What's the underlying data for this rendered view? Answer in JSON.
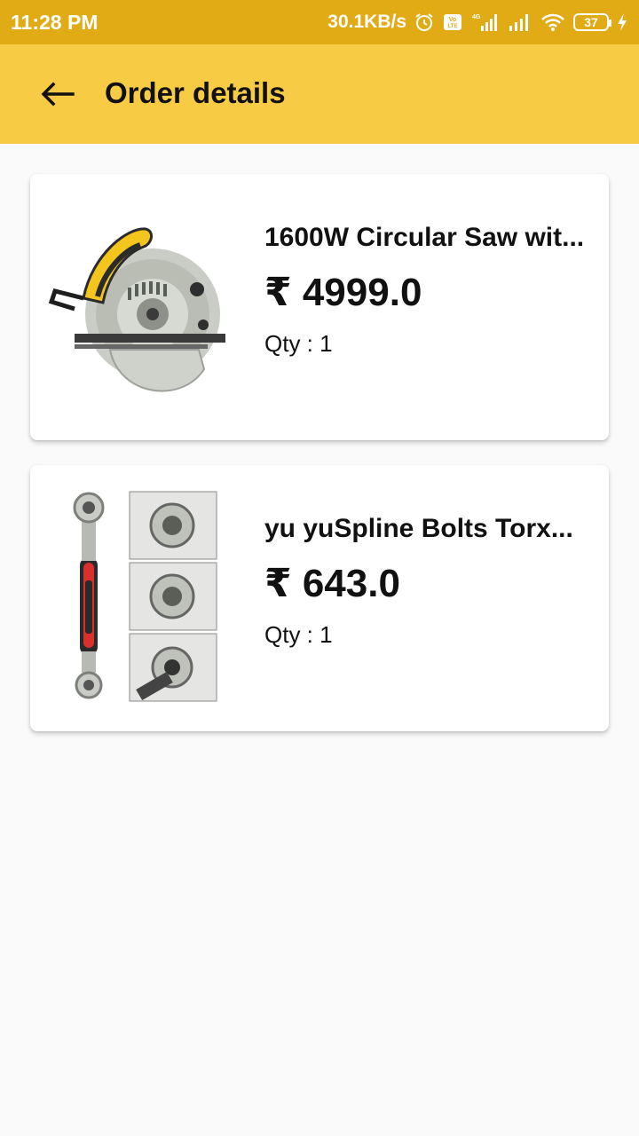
{
  "status_bar": {
    "time": "11:28 PM",
    "net_speed": "30.1KB/s",
    "battery": "37",
    "icons": [
      "alarm-icon",
      "volte-icon",
      "signal-4g-icon",
      "signal-icon",
      "wifi-icon",
      "battery-icon",
      "charging-icon"
    ]
  },
  "header": {
    "title": "Order details",
    "back_icon": "arrow-left-icon"
  },
  "colors": {
    "status_bar": "#e1ab16",
    "app_bar": "#f8cb44",
    "background": "#fafafa",
    "card": "#ffffff"
  },
  "orders": [
    {
      "name": "1600W Circular Saw wit...",
      "price": "₹ 4999.0",
      "qty": "Qty : 1",
      "image": "circular-saw-image"
    },
    {
      "name": "yu yuSpline Bolts Torx...",
      "price": "₹ 643.0",
      "qty": "Qty : 1",
      "image": "wrench-image"
    }
  ]
}
